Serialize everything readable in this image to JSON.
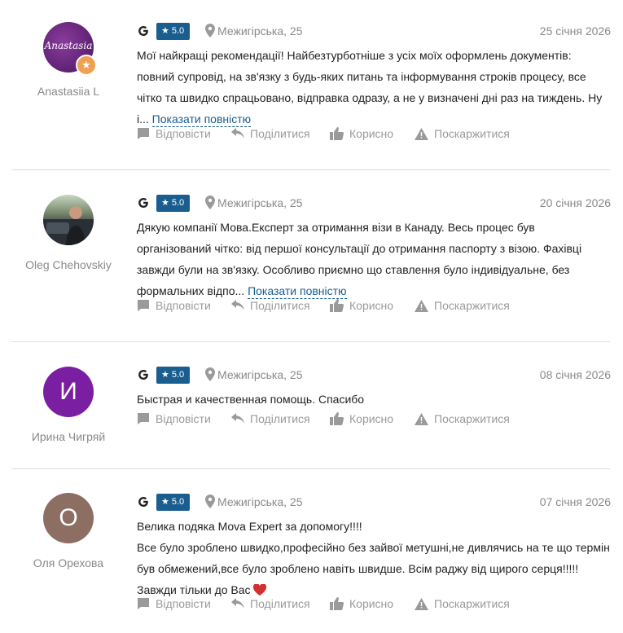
{
  "reviews": [
    {
      "author": "Anastasiia L",
      "avatar_text": "Anastasia",
      "avatar_color": "#6a2a7a",
      "rating": "5.0",
      "place": "Межигірська, 25",
      "date": "25 січня 2026",
      "text": "Мої найкращі рекомендації! Найбезтурботніше з усіх моїх оформлень документів: повний супровід, на зв'язку з будь-яких питань та інформування строків процесу, все чітко та швидко спрацьовано, відправка одразу, а не у визначені дні раз на тиждень. Ну і...",
      "more": "Показати повністю"
    },
    {
      "author": "Oleg Chehovskiy",
      "avatar_color": "#55606a",
      "rating": "5.0",
      "place": "Межигірська, 25",
      "date": "20 січня 2026",
      "text": "Дякую компанії Мова.Експерт за отримання візи в Канаду. Весь процес був організований чітко: від першої консультації до отримання паспорту з візою. Фахівці завжди були на зв'язку. Особливо приємно що ставлення було індивідуальне, без формальних відпо...",
      "more": "Показати повністю"
    },
    {
      "author": "Ирина Чигряй",
      "avatar_letter": "И",
      "avatar_color": "#7b1fa2",
      "rating": "5.0",
      "place": "Межигірська, 25",
      "date": "08 січня 2026",
      "text": "Быстрая и качественная помощь. Спасибо"
    },
    {
      "author": "Оля Орехова",
      "avatar_letter": "О",
      "avatar_color": "#8d6e63",
      "rating": "5.0",
      "place": "Межигірська, 25",
      "date": "07 січня 2026",
      "text_lines": [
        "Велика подяка Mova Expert за допомогу!!!!",
        "Все було зроблено швидко,професійно без зайвої метушні,не дивлячись на те що термін був обмежений,все було зроблено навіть швидше. Всім раджу від щирого серця!!!!!",
        "Завжди тільки до Вас"
      ],
      "heart_icon": "heart-icon"
    }
  ],
  "actions": {
    "reply": "Відповісти",
    "share": "Поділитися",
    "useful": "Корисно",
    "report": "Поскаржитися"
  },
  "colors": {
    "accent": "#1a5d8f",
    "muted": "#8a8a8a"
  }
}
